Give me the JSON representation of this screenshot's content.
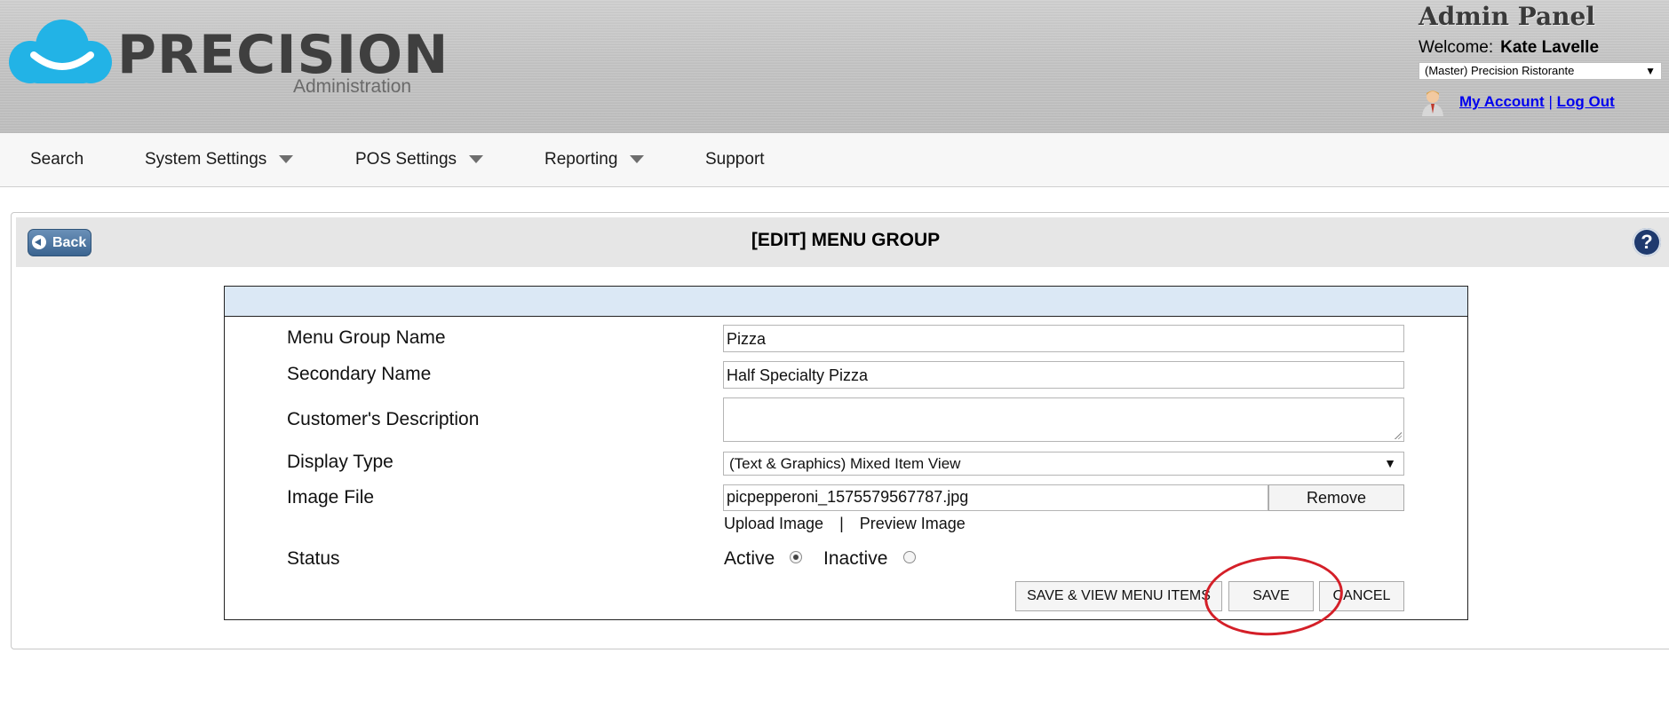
{
  "header": {
    "logo_text": "PRECISION",
    "logo_subtitle": "Administration",
    "panel_title": "Admin Panel",
    "welcome_label": "Welcome:",
    "user_name": "Kate Lavelle",
    "location_select": "(Master) Precision Ristorante",
    "my_account_link": "My Account",
    "separator": "|",
    "logout_link": "Log Out",
    "user_icon": "user-avatar-icon"
  },
  "nav": {
    "items": [
      {
        "label": "Search",
        "has_dropdown": false
      },
      {
        "label": "System Settings",
        "has_dropdown": true
      },
      {
        "label": "POS Settings",
        "has_dropdown": true
      },
      {
        "label": "Reporting",
        "has_dropdown": true
      },
      {
        "label": "Support",
        "has_dropdown": false
      }
    ]
  },
  "page": {
    "back_label": "Back",
    "title": "[EDIT] MENU GROUP",
    "help_label": "?"
  },
  "form": {
    "fields": {
      "menu_group_name": {
        "label": "Menu Group Name",
        "value": "Pizza"
      },
      "secondary_name": {
        "label": "Secondary Name",
        "value": "Half Specialty Pizza"
      },
      "customer_description": {
        "label": "Customer's Description",
        "value": ""
      },
      "display_type": {
        "label": "Display Type",
        "value": "(Text & Graphics) Mixed Item View"
      },
      "image_file": {
        "label": "Image File",
        "value": "picpepperoni_1575579567787.jpg",
        "remove_label": "Remove"
      },
      "status": {
        "label": "Status",
        "options": [
          "Active",
          "Inactive"
        ],
        "selected": "Active"
      }
    },
    "image_links": {
      "upload": "Upload Image",
      "separator": "|",
      "preview": "Preview Image"
    },
    "buttons": {
      "save_view": "SAVE & VIEW MENU ITEMS",
      "save": "SAVE",
      "cancel": "CANCEL"
    }
  },
  "colors": {
    "link": "#0000ee",
    "form_header": "#dbe8f5",
    "back_button": "#3b6490",
    "help_button": "#1f3a6e",
    "annotation": "#d41f28"
  }
}
